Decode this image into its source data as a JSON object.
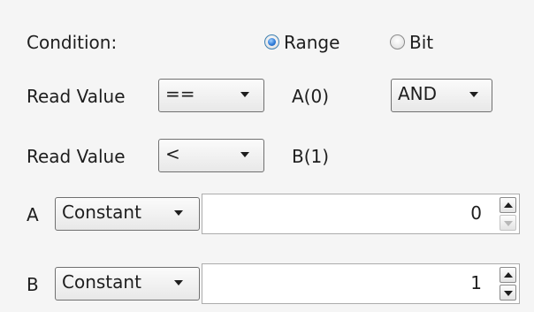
{
  "condition": {
    "label": "Condition:",
    "options": [
      {
        "label": "Range",
        "checked": true
      },
      {
        "label": "Bit",
        "checked": false
      }
    ]
  },
  "rows": [
    {
      "label": "Read Value",
      "operator": "==",
      "operand_label": "A(0)",
      "logic": "AND"
    },
    {
      "label": "Read Value",
      "operator": "<",
      "operand_label": "B(1)"
    }
  ],
  "operands": [
    {
      "name": "A",
      "type": "Constant",
      "value": "0",
      "down_enabled": false
    },
    {
      "name": "B",
      "type": "Constant",
      "value": "1",
      "down_enabled": true
    }
  ]
}
